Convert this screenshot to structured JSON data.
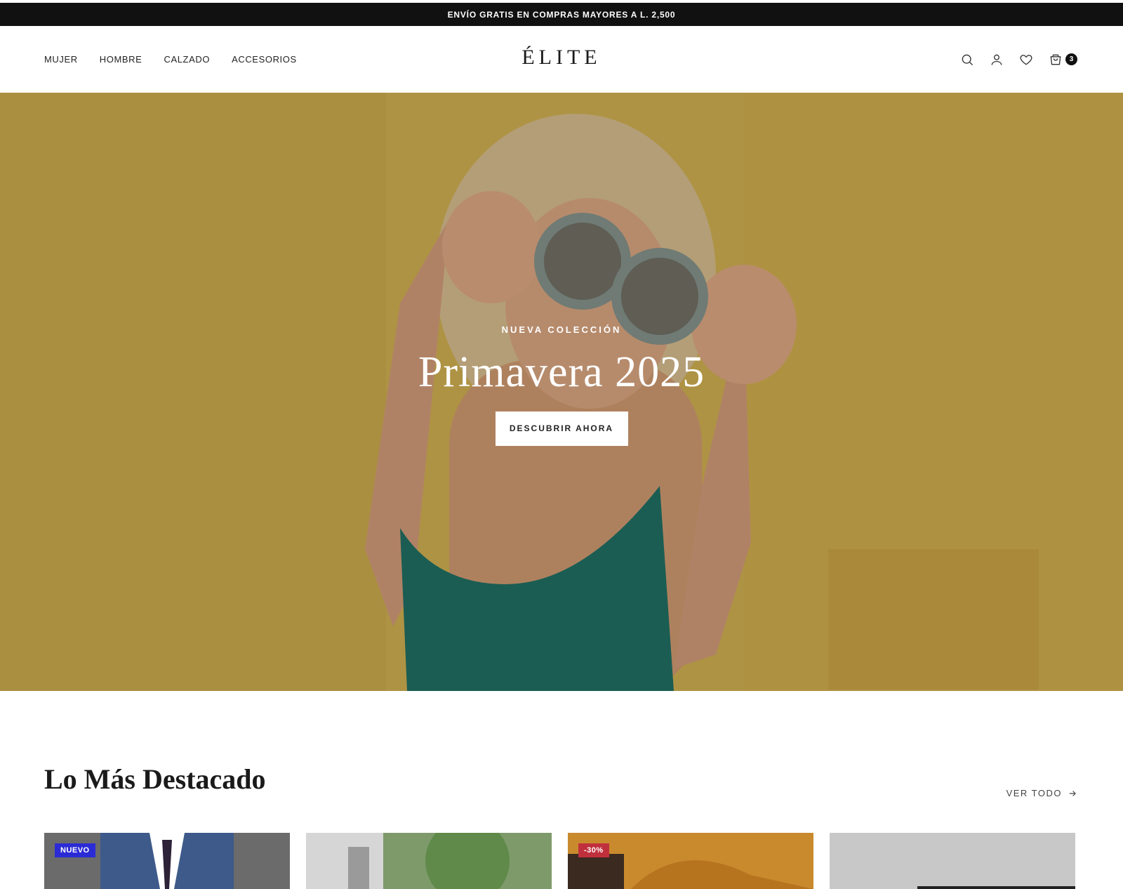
{
  "announcement": "ENVÍO GRATIS EN COMPRAS MAYORES A L. 2,500",
  "nav": {
    "items": [
      "MUJER",
      "HOMBRE",
      "CALZADO",
      "ACCESORIOS"
    ]
  },
  "brand": {
    "logo": "ÉLITE"
  },
  "header_icons": {
    "search": "search-icon",
    "account": "user-icon",
    "wishlist": "heart-icon",
    "cart": "bag-icon",
    "cart_count": "3"
  },
  "hero": {
    "kicker": "NUEVA COLECCIÓN",
    "title": "Primavera 2025",
    "cta": "DESCUBRIR AHORA"
  },
  "featured": {
    "title": "Lo Más Destacado",
    "view_all": "VER TODO",
    "products": [
      {
        "badge": "NUEVO",
        "badge_color": "#2b2bd6",
        "image_color": "#6a6a6a"
      },
      {
        "badge": "",
        "badge_color": "",
        "image_color": "#8fb07a"
      },
      {
        "badge": "-30%",
        "badge_color": "#c0303c",
        "image_color": "#c98a2e"
      },
      {
        "badge": "",
        "badge_color": "",
        "image_color": "#c8c8c8"
      }
    ]
  },
  "colors": {
    "topbar_bg": "#111111",
    "hero_bg": "#c4a54a",
    "badge_new": "#2b2bd6",
    "badge_sale": "#c0303c"
  }
}
